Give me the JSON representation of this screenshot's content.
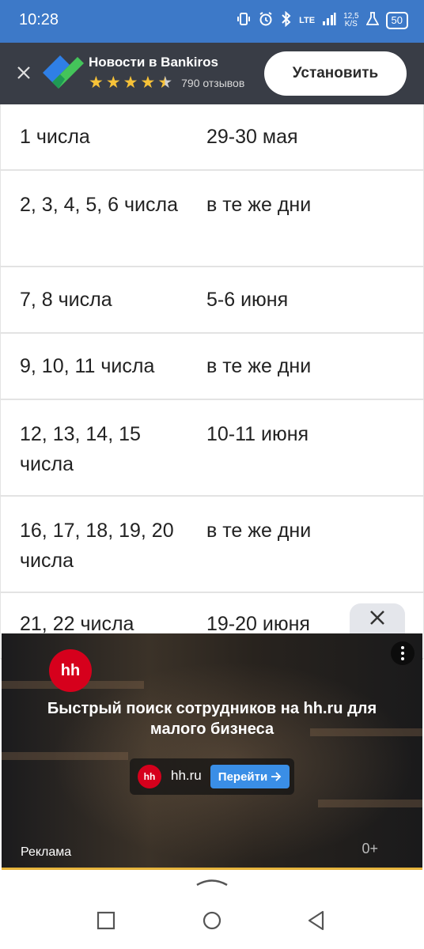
{
  "status_bar": {
    "time": "10:28",
    "network": "LTE",
    "speed_value": "12,5",
    "speed_unit": "K/S",
    "battery": "50"
  },
  "app_banner": {
    "title": "Новости в Bankiros",
    "rating": 4.5,
    "reviews": "790 отзывов",
    "install_label": "Установить"
  },
  "schedule_table": {
    "rows": [
      {
        "dates": "1 числа",
        "payment": "29-30 мая"
      },
      {
        "dates": "2, 3, 4, 5, 6 числа",
        "payment": "в те же дни"
      },
      {
        "dates": "7, 8 числа",
        "payment": "5-6 июня"
      },
      {
        "dates": "9, 10, 11 числа",
        "payment": "в те же дни"
      },
      {
        "dates": "12, 13, 14, 15 числа",
        "payment": "10-11 июня"
      },
      {
        "dates": "16, 17, 18, 19, 20 числа",
        "payment": "в те же дни"
      },
      {
        "dates": "21, 22 числа",
        "payment": "19-20 июня"
      }
    ]
  },
  "ad": {
    "logo_text": "hh",
    "headline": "Быстрый поиск сотрудников на hh.ru для малого бизнеса",
    "domain": "hh.ru",
    "cta_label": "Перейти",
    "ad_label": "Реклама",
    "age_rating": "0+"
  },
  "colors": {
    "status_bar": "#3d79c8",
    "banner_bg": "#393d46",
    "star": "#f7c238",
    "hh_red": "#d6001c",
    "cta_blue": "#3a8ee6"
  }
}
